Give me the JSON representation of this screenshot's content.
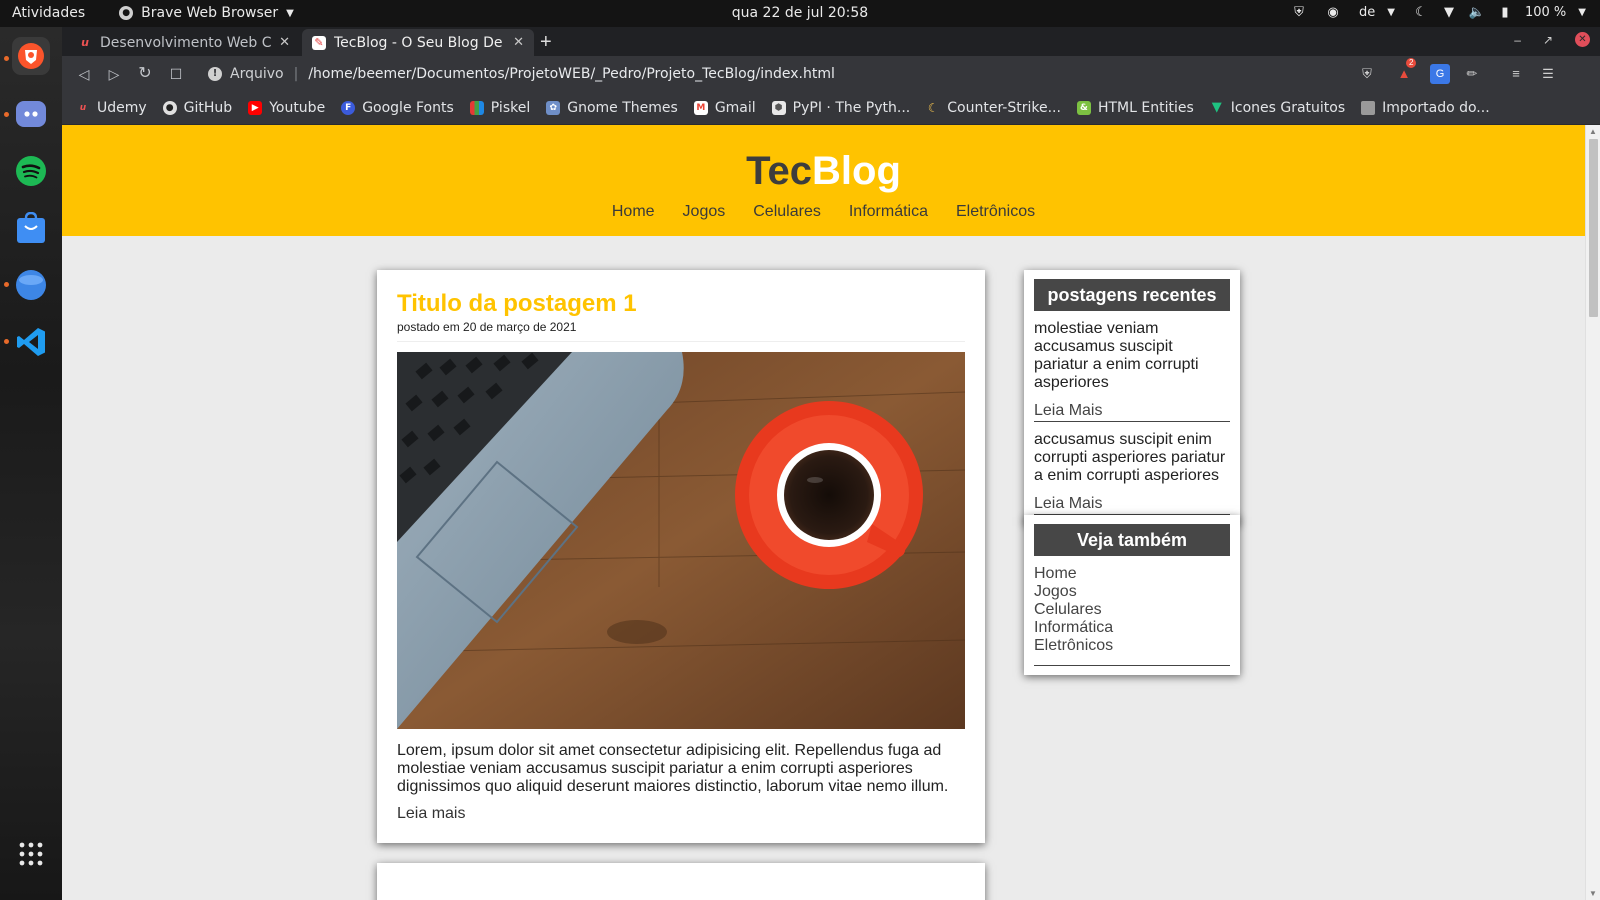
{
  "topbar": {
    "activities": "Atividades",
    "app_name": "Brave Web Browser",
    "clock": "qua 22 de jul  20:58",
    "keyboard_layout": "de",
    "battery": "100 %"
  },
  "dock": {
    "items": [
      "brave-icon",
      "discord-icon",
      "spotify-icon",
      "software-store-icon",
      "files-icon",
      "vscode-icon",
      "app-grid-icon"
    ]
  },
  "browser": {
    "tabs": [
      {
        "title": "Desenvolvimento Web Com",
        "favicon": "udemy-icon",
        "active": false
      },
      {
        "title": "TecBlog - O Seu Blog De tec",
        "favicon": "tecblog-icon",
        "active": true
      }
    ],
    "url_scheme": "Arquivo",
    "url": "/home/beemer/Documentos/ProjetoWEB/_Pedro/Projeto_TecBlog/index.html",
    "bookmarks": [
      {
        "label": "Udemy",
        "icon": "udemy-icon",
        "color": "#ec5252"
      },
      {
        "label": "GitHub",
        "icon": "github-icon",
        "color": "#e0e0e0"
      },
      {
        "label": "Youtube",
        "icon": "youtube-icon",
        "color": "#ff0000"
      },
      {
        "label": "Google Fonts",
        "icon": "google-fonts-icon",
        "color": "#3b5bdb"
      },
      {
        "label": "Piskel",
        "icon": "piskel-icon",
        "color": "#4caf50"
      },
      {
        "label": "Gnome Themes",
        "icon": "gnome-themes-icon",
        "color": "#6f8fc8"
      },
      {
        "label": "Gmail",
        "icon": "gmail-icon",
        "color": "#ea4335"
      },
      {
        "label": "PyPI · The Pyth...",
        "icon": "pypi-icon",
        "color": "#e8e8e8"
      },
      {
        "label": "Counter-Strike...",
        "icon": "counter-strike-icon",
        "color": "#f2c14e"
      },
      {
        "label": "HTML Entities",
        "icon": "html-entities-icon",
        "color": "#7cc142"
      },
      {
        "label": "Icones Gratuitos",
        "icon": "icones-gratuitos-icon",
        "color": "#1fc281"
      },
      {
        "label": "Importado do...",
        "icon": "folder-icon",
        "color": "#9a9a9a"
      }
    ],
    "shields_badge": "2"
  },
  "site": {
    "logo_part1": "Tec",
    "logo_part2": "Blog",
    "nav": [
      "Home",
      "Jogos",
      "Celulares",
      "Informática",
      "Eletrônicos"
    ],
    "accent_color": "#ffc300",
    "post": {
      "title": "Titulo da postagem 1",
      "date": "postado em 20 de março de 2021",
      "text": "Lorem, ipsum dolor sit amet consectetur adipisicing elit. Repellendus fuga ad molestiae veniam accusamus suscipit pariatur a enim corrupti asperiores dignissimos quo aliquid deserunt maiores distinctio, laborum vitae nemo illum.",
      "read_more": "Leia mais"
    },
    "recent": {
      "heading": "postagens recentes",
      "items": [
        {
          "excerpt": "molestiae veniam accusamus suscipit pariatur a enim corrupti asperiores",
          "more": "Leia Mais"
        },
        {
          "excerpt": "accusamus suscipit enim corrupti asperiores pariatur a enim corrupti asperiores",
          "more": "Leia Mais"
        }
      ]
    },
    "see_also": {
      "heading": "Veja também",
      "links": [
        "Home",
        "Jogos",
        "Celulares",
        "Informática",
        "Eletrônicos"
      ]
    }
  }
}
